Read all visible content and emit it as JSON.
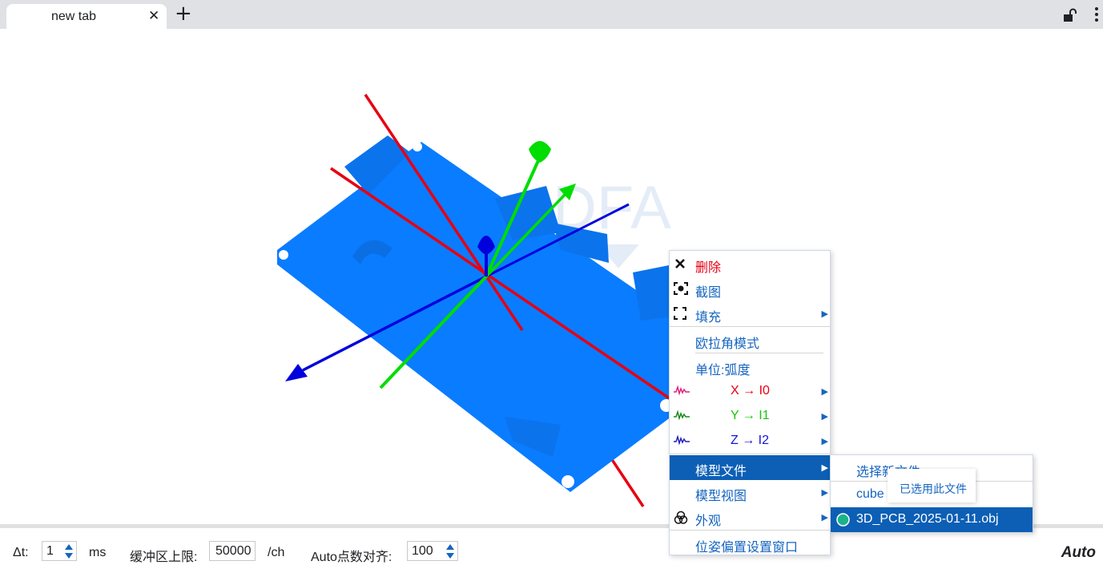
{
  "browser": {
    "tab_title": "new tab",
    "close_glyph": "✕",
    "new_tab_glyph": "+"
  },
  "viewport": {
    "watermark": "DFA",
    "colors": {
      "model": "#0a7cff",
      "x_axis": "#e60012",
      "y_axis": "#00dd00",
      "z_axis": "#0000dd"
    }
  },
  "context_menu": {
    "items": [
      {
        "label": "删除",
        "icon": "close-icon",
        "color": "#e60012"
      },
      {
        "label": "截图",
        "icon": "screenshot-icon"
      },
      {
        "label": "填充",
        "icon": "fill-icon",
        "has_submenu": true
      },
      {
        "label": "欧拉角模式"
      },
      {
        "label": "单位:弧度"
      },
      {
        "label": "X → I0",
        "icon": "waveform-icon",
        "color": "#e60012",
        "icon_color": "#e0207f",
        "has_submenu": true
      },
      {
        "label": "Y → I1",
        "icon": "waveform-icon",
        "color": "#16c60c",
        "icon_color": "#1a8a1a",
        "has_submenu": true
      },
      {
        "label": "Z → I2",
        "icon": "waveform-icon",
        "color": "#1515d6",
        "icon_color": "#2020c0",
        "has_submenu": true
      },
      {
        "label": "模型文件",
        "active": true,
        "has_submenu": true
      },
      {
        "label": "模型视图",
        "has_submenu": true
      },
      {
        "label": "外观",
        "icon": "appearance-icon",
        "has_submenu": true
      },
      {
        "label": "位姿偏置设置窗口"
      }
    ],
    "arrow_glyph": "▶"
  },
  "model_file_submenu": {
    "items": [
      {
        "label": "选择新文件"
      },
      {
        "label": "cube"
      },
      {
        "label": "3D_PCB_2025-01-11.obj",
        "selected": true
      }
    ],
    "tooltip": "已选用此文件"
  },
  "toolbar": {
    "dt_label": "Δt:",
    "dt_value": "1",
    "dt_unit": "ms",
    "buffer_label": "缓冲区上限:",
    "buffer_value": "50000",
    "buffer_unit": "/ch",
    "align_label": "Auto点数对齐:",
    "align_value": "100",
    "auto_label": "Auto"
  }
}
